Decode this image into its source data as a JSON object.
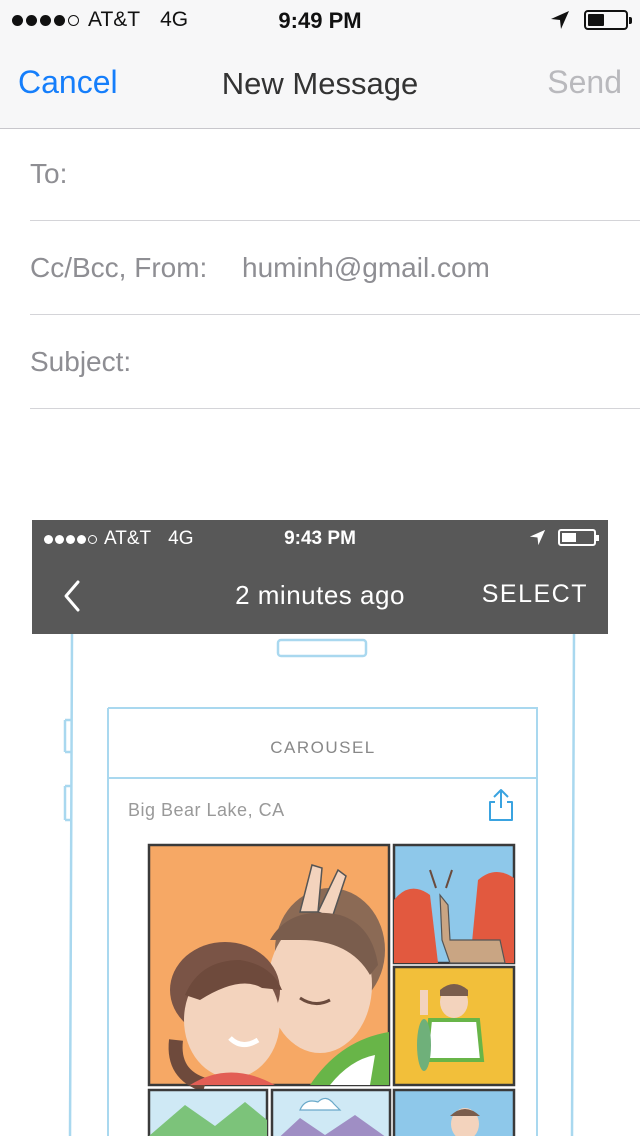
{
  "status_bar": {
    "carrier": "AT&T",
    "network": "4G",
    "time": "9:49 PM"
  },
  "nav": {
    "cancel_label": "Cancel",
    "title": "New Message",
    "send_label": "Send"
  },
  "fields": {
    "to_label": "To:",
    "cc_label": "Cc/Bcc, From:",
    "from_value": "huminh@gmail.com",
    "subject_label": "Subject:"
  },
  "attachment": {
    "status_bar": {
      "carrier": "AT&T",
      "network": "4G",
      "time": "9:43 PM"
    },
    "nav": {
      "title": "2 minutes ago",
      "select_label": "SELECT"
    },
    "app_title": "CAROUSEL",
    "location": "Big Bear Lake, CA"
  },
  "colors": {
    "accent": "#157efb",
    "disabled": "#b9b9bd",
    "embedded_bar": "#585858",
    "sketch_line": "#a9d8ef"
  },
  "icons": [
    "location-arrow-icon",
    "battery-icon",
    "back-chevron-icon",
    "share-icon"
  ]
}
